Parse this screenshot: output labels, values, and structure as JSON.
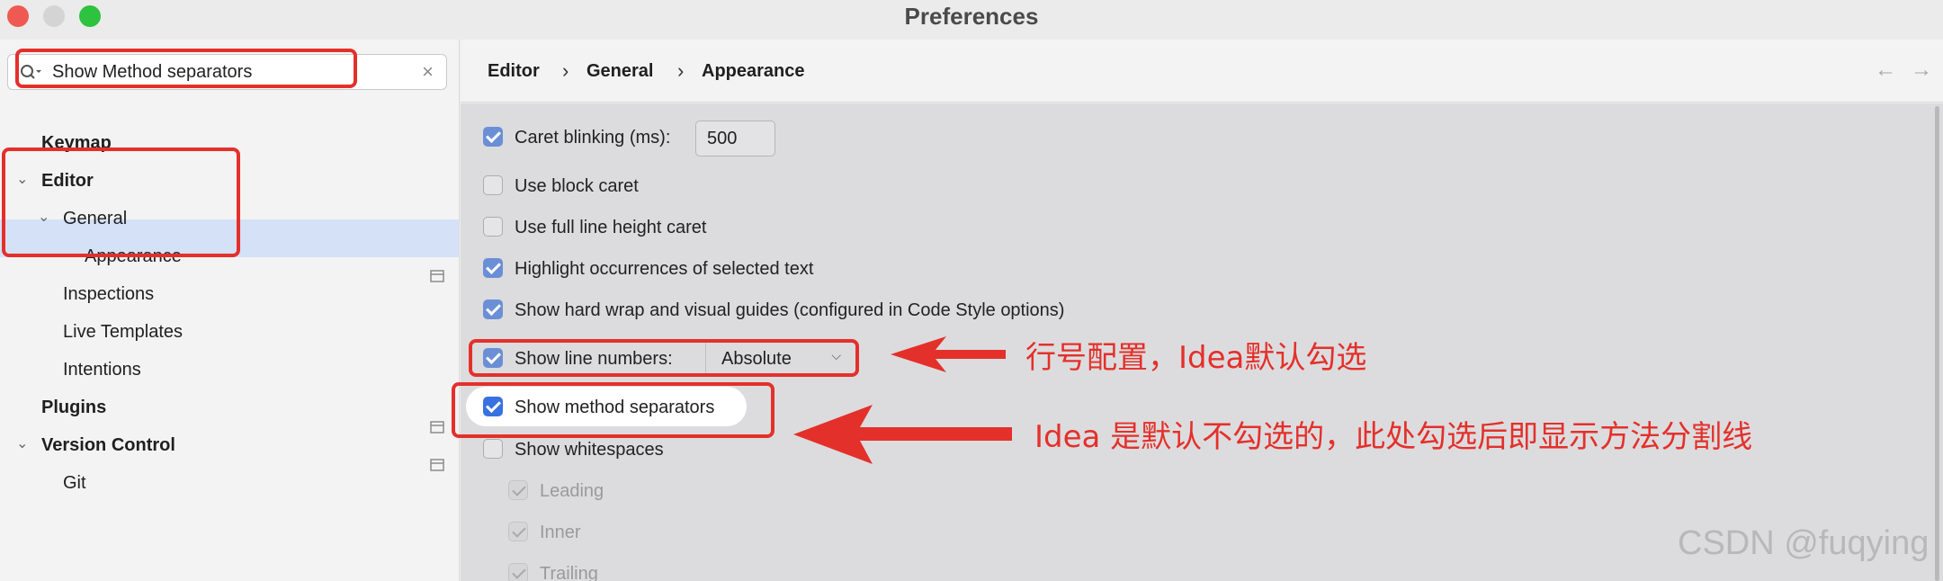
{
  "window": {
    "title": "Preferences"
  },
  "search": {
    "value": "Show Method separators",
    "clear": "×"
  },
  "tree": {
    "items": [
      {
        "label": "Keymap"
      },
      {
        "label": "Editor"
      },
      {
        "label": "General"
      },
      {
        "label": "Appearance"
      },
      {
        "label": "Inspections"
      },
      {
        "label": "Live Templates"
      },
      {
        "label": "Intentions"
      },
      {
        "label": "Plugins"
      },
      {
        "label": "Version Control"
      },
      {
        "label": "Git"
      }
    ]
  },
  "breadcrumb": {
    "items": [
      "Editor",
      "General",
      "Appearance"
    ],
    "separator": "›",
    "back": "←",
    "forward": "→"
  },
  "options": {
    "caret_blinking": {
      "label": "Caret blinking (ms):",
      "value": "500",
      "checked": true
    },
    "block_caret": {
      "label": "Use block caret",
      "checked": false
    },
    "full_line_caret": {
      "label": "Use full line height caret",
      "checked": false
    },
    "highlight_occurrences": {
      "label": "Highlight occurrences of selected text",
      "checked": true
    },
    "hard_wrap": {
      "label": "Show hard wrap and visual guides (configured in Code Style options)",
      "checked": true
    },
    "line_numbers": {
      "label": "Show line numbers:",
      "value": "Absolute",
      "checked": true
    },
    "method_separators": {
      "label": "Show method separators",
      "checked": true
    },
    "whitespaces": {
      "label": "Show whitespaces",
      "checked": false
    },
    "leading": {
      "label": "Leading",
      "checked": true
    },
    "inner": {
      "label": "Inner",
      "checked": true
    },
    "trailing": {
      "label": "Trailing",
      "checked": true
    }
  },
  "annotations": {
    "line_numbers_note": "行号配置，Idea默认勾选",
    "method_separators_note": "Idea 是默认不勾选的，此处勾选后即显示方法分割线"
  },
  "watermark": "CSDN @fuqying",
  "colors": {
    "accent": "#6b8fd6",
    "annotation": "#e4302b",
    "selection": "#d5e1f7"
  }
}
